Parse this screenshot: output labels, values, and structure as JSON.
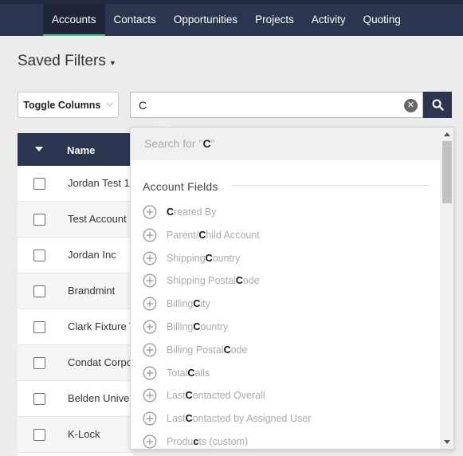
{
  "nav": {
    "tabs": [
      {
        "label": "Accounts",
        "active": true
      },
      {
        "label": "Contacts",
        "active": false
      },
      {
        "label": "Opportunities",
        "active": false
      },
      {
        "label": "Projects",
        "active": false
      },
      {
        "label": "Activity",
        "active": false
      },
      {
        "label": "Quoting",
        "active": false
      }
    ]
  },
  "saved_filters": {
    "label": "Saved Filters"
  },
  "toolbar": {
    "toggle_columns_label": "Toggle Columns"
  },
  "search": {
    "value": "C",
    "clear_icon": "close-circle-icon",
    "submit_icon": "search-icon"
  },
  "table": {
    "header": {
      "name_label": "Name"
    },
    "rows": [
      {
        "name": "Jordan Test 1"
      },
      {
        "name": "Test Account"
      },
      {
        "name": "Jordan Inc"
      },
      {
        "name": "Brandmint"
      },
      {
        "name": "Clark Fixture T"
      },
      {
        "name": "Condat Corpo"
      },
      {
        "name": "Belden Univer"
      },
      {
        "name": "K-Lock"
      }
    ]
  },
  "dropdown": {
    "search_for_prefix": "Search for \"",
    "search_for_term": "C",
    "search_for_suffix": "\"",
    "section_title": "Account Fields",
    "fields": [
      {
        "pre": "",
        "match": "C",
        "post": "reated By"
      },
      {
        "pre": "Parent/",
        "match": "C",
        "post": "hild Account"
      },
      {
        "pre": "Shipping ",
        "match": "C",
        "post": "ountry"
      },
      {
        "pre": "Shipping Postal ",
        "match": "C",
        "post": "ode"
      },
      {
        "pre": "Billing ",
        "match": "C",
        "post": "ity"
      },
      {
        "pre": "Billing ",
        "match": "C",
        "post": "ountry"
      },
      {
        "pre": "Billing Postal ",
        "match": "C",
        "post": "ode"
      },
      {
        "pre": "Total ",
        "match": "C",
        "post": "alls"
      },
      {
        "pre": "Last ",
        "match": "C",
        "post": "ontacted Overall"
      },
      {
        "pre": "Last ",
        "match": "C",
        "post": "ontacted by Assigned User"
      },
      {
        "pre": "Produ",
        "match": "c",
        "post": "ts (custom)"
      }
    ]
  },
  "colors": {
    "nav_bg": "#2b3550",
    "active_tab_bg": "#1e2539",
    "active_tab_accent": "#3cc87a",
    "page_bg": "#ececec"
  }
}
